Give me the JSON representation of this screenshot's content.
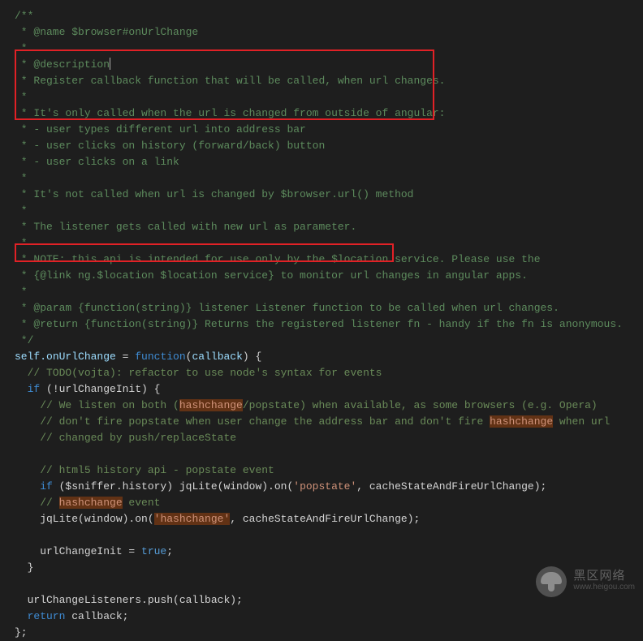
{
  "code": {
    "l01": "/**",
    "l02": " * @name $browser#onUrlChange",
    "l03": " *",
    "l04": " * @description",
    "l05": " * Register callback function that will be called, when url changes.",
    "l06": " *",
    "l07": " * It's only called when the url is changed from outside of angular:",
    "l08": " * - user types different url into address bar",
    "l09": " * - user clicks on history (forward/back) button",
    "l10": " * - user clicks on a link",
    "l11": " *",
    "l12": " * It's not called when url is changed by $browser.url() method",
    "l13": " *",
    "l14": " * The listener gets called with new url as parameter.",
    "l15": " *",
    "l16": " * NOTE: this api is intended for use only by the $location service. Please use the",
    "l17": " * {@link ng.$location $location service} to monitor url changes in angular apps.",
    "l18": " *",
    "l19": " * @param {function(string)} listener Listener function to be called when url changes.",
    "l20": " * @return {function(string)} Returns the registered listener fn - handy if the fn is anonymous.",
    "l21": " */",
    "l22_self": "self",
    "l22_prop": ".onUrlChange",
    "l22_eq": " = ",
    "l22_fn": "function",
    "l22_open": "(",
    "l22_cb": "callback",
    "l22_close": ") {",
    "l23": "  // TODO(vojta): refactor to use node's syntax for events",
    "l24_if": "  if",
    "l24_rest": " (!urlChangeInit) {",
    "l25a": "    // We listen on both (",
    "l25b": "hashchange",
    "l25c": "/popstate) when available, as some browsers (e.g. Opera)",
    "l26a": "    // don't fire popstate when user change the address bar and don't fire ",
    "l26b": "hashchange",
    "l26c": " when url",
    "l27": "    // changed by push/replaceState",
    "l28": "",
    "l29": "    // html5 history api - popstate event",
    "l30_if": "    if",
    "l30_mid": " ($sniffer.history) jqLite(window).on(",
    "l30_str": "'popstate'",
    "l30_end": ", cacheStateAndFireUrlChange);",
    "l31a": "    // ",
    "l31b": "hashchange",
    "l31c": " event",
    "l32a": "    jqLite(window).on(",
    "l32b": "'hashchange'",
    "l32c": ", cacheStateAndFireUrlChange);",
    "l33": "",
    "l34a": "    urlChangeInit = ",
    "l34b": "true",
    "l34c": ";",
    "l35": "  }",
    "l36": "",
    "l37": "  urlChangeListeners.push(callback);",
    "l38_ret": "  return",
    "l38_val": " callback;",
    "l39": "};"
  },
  "watermark": {
    "title": "黑区网络",
    "url": "www.heigou.com"
  }
}
